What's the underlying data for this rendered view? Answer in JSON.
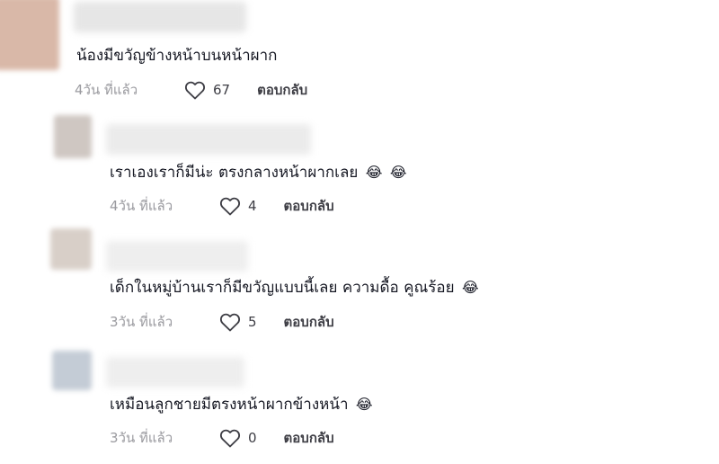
{
  "comments": [
    {
      "avatar_color": "#d9b8a8",
      "text": "น้องมีขวัญข้างหน้าบนหน้าผาก",
      "emojis": [],
      "time": "4วัน ที่แล้ว",
      "likes": "67",
      "reply_label": "ตอบกลับ"
    },
    {
      "avatar_color": "#cfc7c2",
      "text": "เราเองเราก็มีน่ะ ตรงกลางหน้าผากเลย",
      "emojis": [
        "😂",
        "😂"
      ],
      "time": "4วัน ที่แล้ว",
      "likes": "4",
      "reply_label": "ตอบกลับ"
    },
    {
      "avatar_color": "#d8cfc8",
      "text": "เด็กในหมู่บ้านเราก็มีขวัญแบบนี้เลย ความดื้อ คูณร้อย",
      "emojis": [
        "😂"
      ],
      "time": "3วัน ที่แล้ว",
      "likes": "5",
      "reply_label": "ตอบกลับ"
    },
    {
      "avatar_color": "#c4ccd6",
      "text": "เหมือนลูกชายมีตรงหน้าผากข้างหน้า",
      "emojis": [
        "😂"
      ],
      "time": "3วัน ที่แล้ว",
      "likes": "0",
      "reply_label": "ตอบกลับ"
    }
  ],
  "icons": {
    "like": "heart-outline-icon",
    "laugh": "face-with-tears-of-joy-icon"
  }
}
